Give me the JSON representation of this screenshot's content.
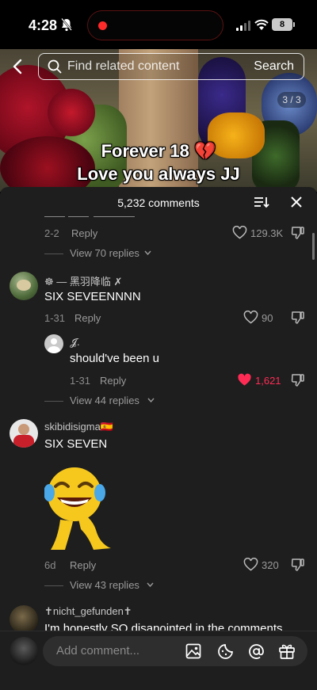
{
  "status_bar": {
    "time": "4:28",
    "battery": "8"
  },
  "video": {
    "search_placeholder": "Find related content",
    "search_button": "Search",
    "pager": "3 / 3",
    "caption_line1": "Forever 18 💔",
    "caption_line2": "Love you always JJ"
  },
  "comments_header": {
    "count_label": "5,232 comments"
  },
  "comments": [
    {
      "date": "2-2",
      "reply": "Reply",
      "likes": "129.3K",
      "view_replies": "View 70 replies"
    },
    {
      "username": "☸ — 黑羽降临 ✗",
      "text": "SIX SEVEENNNN",
      "date": "1-31",
      "reply": "Reply",
      "likes": "90"
    },
    {
      "username": "𝓙.",
      "text": "should've been u",
      "date": "1-31",
      "reply": "Reply",
      "likes": "1,621",
      "view_replies": "View 44 replies"
    },
    {
      "username": "skibidisigma🇪🇸",
      "text": "SIX SEVEN",
      "date": "6d",
      "reply": "Reply",
      "likes": "320",
      "view_replies": "View 43 replies"
    },
    {
      "username": "✝nicht_gefunden✝",
      "text": "I'm honestly SO disapointed in the comments"
    }
  ],
  "composer": {
    "placeholder": "Add comment..."
  },
  "colors": {
    "like_active": "#fe2c55",
    "sheet_bg": "#1e1e1e"
  }
}
